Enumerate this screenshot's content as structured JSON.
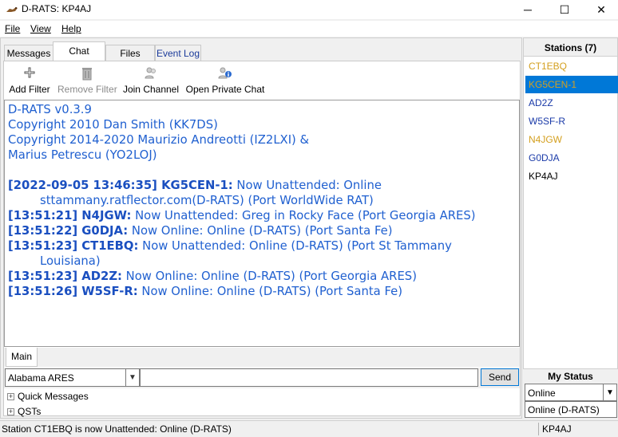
{
  "window": {
    "title": "D-RATS: KP4AJ",
    "min_glyph": "─",
    "max_glyph": "☐",
    "close_glyph": "✕"
  },
  "menu": {
    "file": "File",
    "view": "View",
    "help": "Help"
  },
  "tabs": [
    {
      "label": "Messages"
    },
    {
      "label": "Chat"
    },
    {
      "label": "Files"
    },
    {
      "label": "Event Log"
    }
  ],
  "active_tab": "Chat",
  "toolbar": {
    "add_filter": "Add Filter",
    "remove_filter": "Remove Filter",
    "join_channel": "Join Channel",
    "open_private_chat": "Open Private Chat"
  },
  "chat": {
    "intro": [
      "D-RATS v0.3.9",
      "Copyright 2010 Dan Smith (KK7DS)",
      "Copyright 2014-2020 Maurizio Andreotti (IZ2LXI) &",
      "Marius Petrescu (YO2LOJ)"
    ],
    "messages": [
      {
        "ts": "[2022-09-05 13:46:35] KG5CEN-1:",
        "text": " Now Unattended: Online",
        "cont": "sttammany.ratflector.com(D-RATS) (Port WorldWide RAT)"
      },
      {
        "ts": "[13:51:21] N4JGW:",
        "text": " Now Unattended: Greg in Rocky Face (Port Georgia ARES)",
        "cont": ""
      },
      {
        "ts": "[13:51:22] G0DJA:",
        "text": " Now Online: Online (D-RATS) (Port Santa Fe)",
        "cont": ""
      },
      {
        "ts": "[13:51:23] CT1EBQ:",
        "text": " Now Unattended: Online (D-RATS) (Port St Tammany",
        "cont": "Louisiana)"
      },
      {
        "ts": "[13:51:23] AD2Z:",
        "text": " Now Online: Online (D-RATS) (Port Georgia ARES)",
        "cont": ""
      },
      {
        "ts": "[13:51:26] W5SF-R:",
        "text": " Now Online: Online (D-RATS) (Port Santa Fe)",
        "cont": ""
      }
    ]
  },
  "subtab": "Main",
  "channel_select": "Alabama ARES",
  "send_label": "Send",
  "quick_messages": "Quick Messages",
  "qsts": "QSTs",
  "stations": {
    "header": "Stations (7)",
    "items": [
      {
        "call": "CT1EBQ",
        "color": "#d4a020"
      },
      {
        "call": "KG5CEN-1",
        "color": "#d4a020"
      },
      {
        "call": "AD2Z",
        "color": "#1a3aa8"
      },
      {
        "call": "W5SF-R",
        "color": "#1a3aa8"
      },
      {
        "call": "N4JGW",
        "color": "#d4a020"
      },
      {
        "call": "G0DJA",
        "color": "#1a3aa8"
      },
      {
        "call": "KP4AJ",
        "color": "#000000"
      }
    ],
    "selected": "KG5CEN-1"
  },
  "my_status": {
    "header": "My Status",
    "value": "Online",
    "message": "Online (D-RATS)"
  },
  "statusbar": {
    "message": "Station CT1EBQ is now Unattended: Online (D-RATS)",
    "callsign": "KP4AJ"
  }
}
